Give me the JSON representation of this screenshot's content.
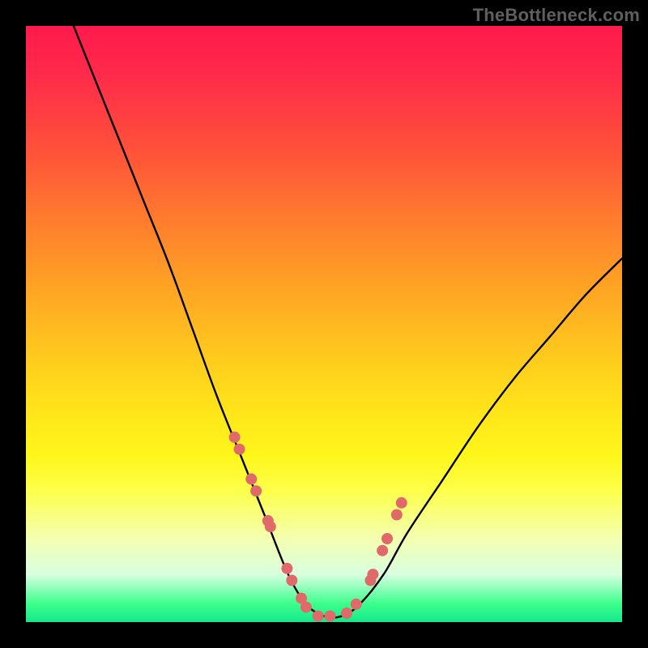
{
  "watermark": "TheBottleneck.com",
  "chart_data": {
    "type": "line",
    "title": "",
    "xlabel": "",
    "ylabel": "",
    "xlim": [
      0,
      100
    ],
    "ylim": [
      0,
      100
    ],
    "series": [
      {
        "name": "curve",
        "x": [
          8,
          12,
          16,
          20,
          24,
          28,
          32,
          36,
          40,
          44,
          47,
          50,
          53,
          56,
          60,
          64,
          70,
          76,
          82,
          88,
          94,
          100
        ],
        "y": [
          100,
          90,
          80,
          70,
          60,
          49,
          38,
          28,
          18,
          8,
          3,
          1,
          1,
          3,
          8,
          15,
          24,
          33,
          41,
          48,
          55,
          61
        ]
      }
    ],
    "markers": {
      "name": "points",
      "color": "#e06a6a",
      "x": [
        35.0,
        35.8,
        37.8,
        38.6,
        40.6,
        41.0,
        43.8,
        44.6,
        46.2,
        47.0,
        49.0,
        51.0,
        53.8,
        55.4,
        57.8,
        58.2,
        59.8,
        60.6,
        62.2,
        63.0
      ],
      "y": [
        31,
        29,
        24,
        22,
        17,
        16,
        9,
        7,
        4,
        2.5,
        1,
        1,
        1.5,
        3,
        7,
        8,
        12,
        14,
        18,
        20
      ]
    },
    "gradient_stops": [
      {
        "pos": 0,
        "color": "#ff1a4d"
      },
      {
        "pos": 22,
        "color": "#ff5538"
      },
      {
        "pos": 44,
        "color": "#ffa424"
      },
      {
        "pos": 66,
        "color": "#ffe81a"
      },
      {
        "pos": 86,
        "color": "#f4ffb0"
      },
      {
        "pos": 97,
        "color": "#3bff8c"
      },
      {
        "pos": 100,
        "color": "#14e88a"
      }
    ]
  }
}
